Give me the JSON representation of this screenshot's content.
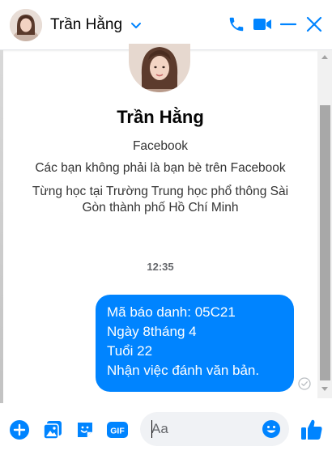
{
  "header": {
    "contact_name": "Trần Hằng"
  },
  "profile": {
    "name": "Trần Hằng",
    "platform": "Facebook",
    "friend_status": "Các bạn không phải là bạn bè trên Facebook",
    "education_line1": "Từng học tại Trường Trung học phổ thông Sài",
    "education_line2": "Gòn thành phố Hồ Chí Minh"
  },
  "conversation": {
    "timestamp": "12:35",
    "messages": [
      {
        "lines": [
          "Mã báo danh: 05C21",
          "Ngày 8tháng 4",
          "Tuổi 22",
          "Nhận việc đánh văn bản."
        ]
      }
    ]
  },
  "composer": {
    "placeholder": "Aa"
  },
  "icons": {
    "header": [
      "avatar",
      "chevron-down-icon",
      "phone-icon",
      "video-camera-icon",
      "minimize-icon",
      "close-icon"
    ],
    "composer": [
      "plus-icon",
      "image-icon",
      "sticker-icon",
      "gif-icon",
      "emoji-icon",
      "thumbs-up-icon"
    ],
    "status": [
      "seen-check-icon"
    ]
  },
  "colors": {
    "accent": "#0084ff",
    "bubble_text": "#ffffff"
  }
}
